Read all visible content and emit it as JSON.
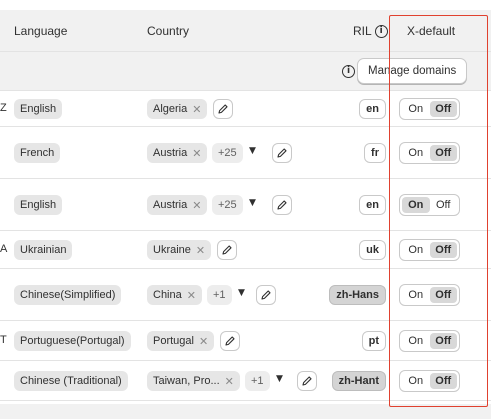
{
  "header": {
    "language": "Language",
    "country": "Country",
    "ril": "RIL",
    "xdefault": "X-default"
  },
  "subbar": {
    "manage_label": "Manage domains"
  },
  "toggle": {
    "on": "On",
    "off": "Off"
  },
  "rows": [
    {
      "mark": "Z",
      "language": "English",
      "country": "Algeria",
      "more": "",
      "ril": "en",
      "ril_grey": false,
      "selected": "off"
    },
    {
      "mark": "",
      "language": "French",
      "country": "Austria",
      "more": "+25",
      "ril": "fr",
      "ril_grey": false,
      "selected": "off"
    },
    {
      "mark": "",
      "language": "English",
      "country": "Austria",
      "more": "+25",
      "ril": "en",
      "ril_grey": false,
      "selected": "on"
    },
    {
      "mark": "A",
      "language": "Ukrainian",
      "country": "Ukraine",
      "more": "",
      "ril": "uk",
      "ril_grey": false,
      "selected": "off"
    },
    {
      "mark": "",
      "language": "Chinese(Simplified)",
      "country": "China",
      "more": "+1",
      "ril": "zh-Hans",
      "ril_grey": true,
      "selected": "off"
    },
    {
      "mark": "T",
      "language": "Portuguese(Portugal)",
      "country": "Portugal",
      "more": "",
      "ril": "pt",
      "ril_grey": false,
      "selected": "off"
    },
    {
      "mark": "",
      "language": "Chinese (Traditional)",
      "country": "Taiwan, Pro...",
      "more": "+1",
      "ril": "zh-Hant",
      "ril_grey": true,
      "selected": "off"
    }
  ],
  "colors": {
    "highlight": "#e0412f",
    "header_bg": "#f1f1f1",
    "chip_bg": "#e6e6e6"
  }
}
